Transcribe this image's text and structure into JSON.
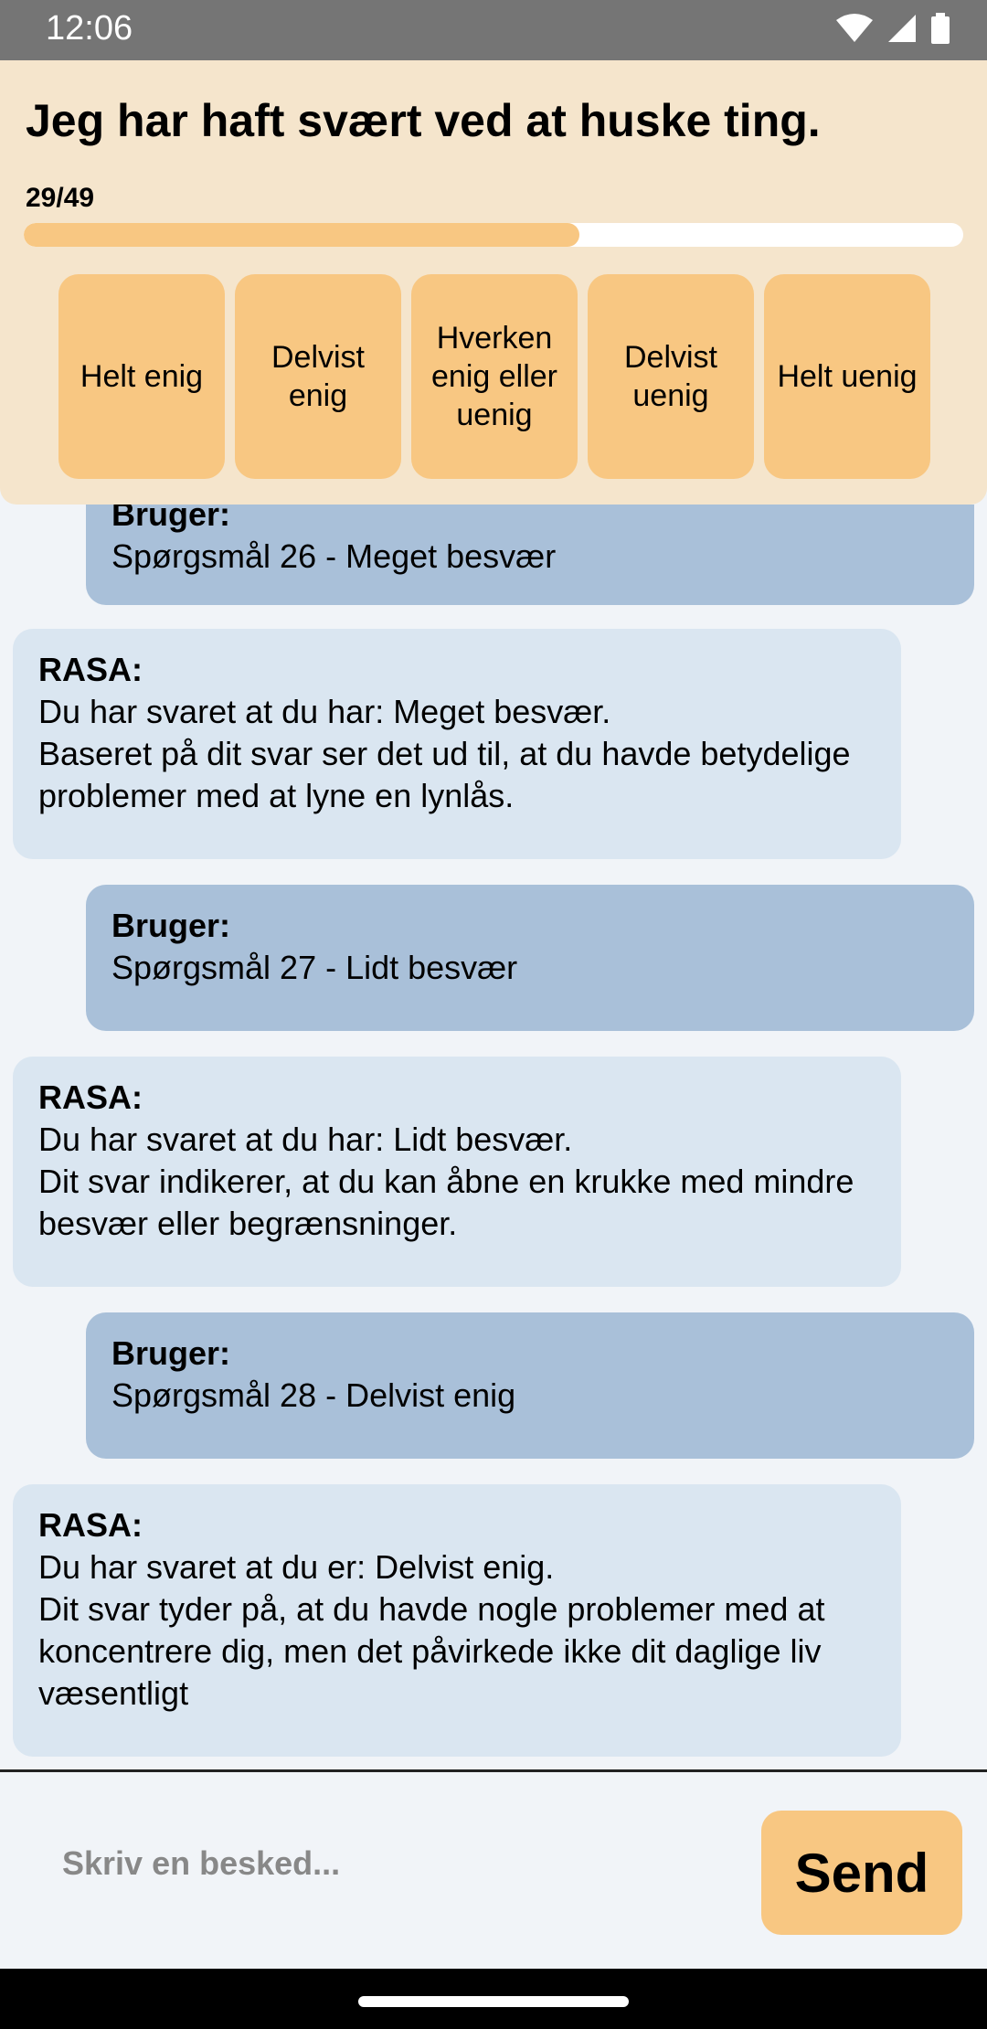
{
  "status": {
    "time": "12:06"
  },
  "question": {
    "title": "Jeg har haft svært ved at huske ting.",
    "progress_label": "29/49",
    "progress_fraction": 0.5917
  },
  "answers": [
    "Helt enig",
    "Delvist enig",
    "Hverken enig eller uenig",
    "Delvist uenig",
    "Helt uenig"
  ],
  "messages": [
    {
      "sender": "Bruger:",
      "lines": [
        "Spørgsmål 26 - Meget besvær"
      ]
    },
    {
      "sender": "RASA:",
      "lines": [
        "Du har svaret at du har: Meget besvær.",
        "Baseret på dit svar ser det ud til, at du havde betydelige problemer med at lyne en lynlås."
      ]
    },
    {
      "sender": "Bruger:",
      "lines": [
        "Spørgsmål 27 - Lidt besvær"
      ]
    },
    {
      "sender": "RASA:",
      "lines": [
        "Du har svaret at du har: Lidt besvær.",
        "Dit svar indikerer, at du kan åbne en krukke med mindre besvær eller begrænsninger."
      ]
    },
    {
      "sender": "Bruger:",
      "lines": [
        "Spørgsmål 28 - Delvist enig"
      ]
    },
    {
      "sender": "RASA:",
      "lines": [
        "Du har svaret at du er: Delvist enig.",
        "Dit svar tyder på, at du havde nogle problemer med at koncentrere dig, men det påvirkede ikke dit daglige liv væsentligt"
      ]
    }
  ],
  "input": {
    "placeholder": "Skriv en besked...",
    "value": ""
  },
  "send_label": "Send",
  "colors": {
    "panel": "#f5e5cc",
    "accent": "#f8c782",
    "user_bubble": "#a9c0d9",
    "bot_bubble": "#dae6f1",
    "background": "#f1f4f8"
  },
  "icons": [
    "wifi-icon",
    "cellular-signal-icon",
    "battery-icon"
  ]
}
